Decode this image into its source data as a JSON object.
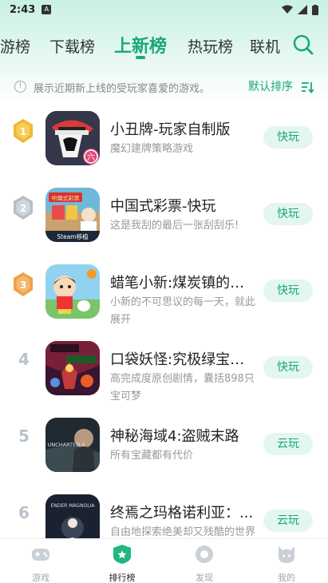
{
  "status_bar": {
    "time": "2:43"
  },
  "tabs": [
    {
      "label": "游榜"
    },
    {
      "label": "下载榜"
    },
    {
      "label": "上新榜",
      "active": true
    },
    {
      "label": "热玩榜"
    },
    {
      "label": "联机"
    }
  ],
  "info": {
    "text": "展示近期新上线的受玩家喜爱的游戏。",
    "sort_label": "默认排序"
  },
  "games": [
    {
      "rank": "1",
      "title": "小丑牌-玩家自制版",
      "desc": "魔幻建牌策略游戏",
      "action": "快玩",
      "icon": "balatro-icon"
    },
    {
      "rank": "2",
      "title": "中国式彩票-快玩",
      "desc": "这是我刮的最后一张刮刮乐!",
      "action": "快玩",
      "icon": "lottery-icon",
      "icon_text": "中国式彩票",
      "icon_badge": "Steam移植"
    },
    {
      "rank": "3",
      "title": "蜡笔小新:煤炭镇的小...",
      "desc": "小新的不可思议的每一天，就此展开",
      "action": "快玩",
      "icon": "crayon-shinchan-icon"
    },
    {
      "rank": "4",
      "title": "口袋妖怪:究极绿宝石...",
      "desc": "高完成度原创剧情，囊括898只宝可梦",
      "action": "快玩",
      "icon": "pokemon-icon"
    },
    {
      "rank": "5",
      "title": "神秘海域4:盗贼末路",
      "desc": "所有宝藏都有代价",
      "action": "云玩",
      "icon": "uncharted-icon",
      "icon_text": "UNCHARTED 4"
    },
    {
      "rank": "6",
      "title": "终焉之玛格诺利亚：...",
      "desc": "自由地探索绝美却又残酷的世界",
      "action": "云玩",
      "icon": "ender-magnolia-icon",
      "icon_text": "ENDER MAGNOLIA"
    }
  ],
  "bottom_nav": [
    {
      "label": "游戏",
      "icon": "gamepad-icon"
    },
    {
      "label": "排行榜",
      "icon": "ranking-icon",
      "active": true
    },
    {
      "label": "发现",
      "icon": "discover-icon"
    },
    {
      "label": "我的",
      "icon": "profile-icon"
    }
  ],
  "colors": {
    "accent": "#1aa877",
    "button_bg": "#e3f7ee",
    "gold": "#f2b632",
    "silver": "#b5bec7",
    "bronze": "#f0a04b"
  }
}
